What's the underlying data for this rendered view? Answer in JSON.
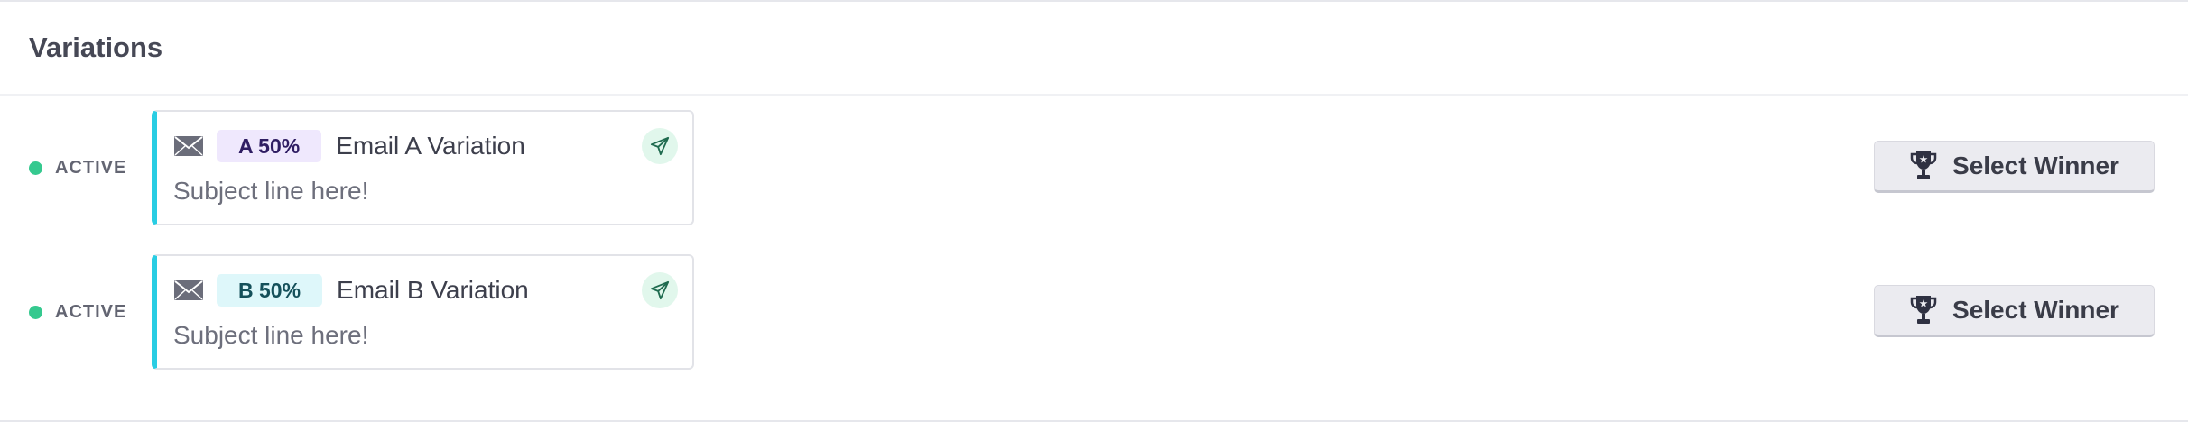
{
  "header": {
    "title": "Variations"
  },
  "variations": [
    {
      "status": "ACTIVE",
      "badge": "A 50%",
      "name": "Email A Variation",
      "subject": "Subject line here!",
      "action_label": "Select Winner"
    },
    {
      "status": "ACTIVE",
      "badge": "B 50%",
      "name": "Email B Variation",
      "subject": "Subject line here!",
      "action_label": "Select Winner"
    }
  ],
  "icons": {
    "type": "envelope-icon",
    "send": "send-icon",
    "winner": "trophy-icon"
  },
  "colors": {
    "active": "#35c98f",
    "card_accent": "#29cde3",
    "badge_a_bg": "#efe8fd",
    "badge_b_bg": "#def7fa",
    "send_bg": "#e1f7ec"
  }
}
